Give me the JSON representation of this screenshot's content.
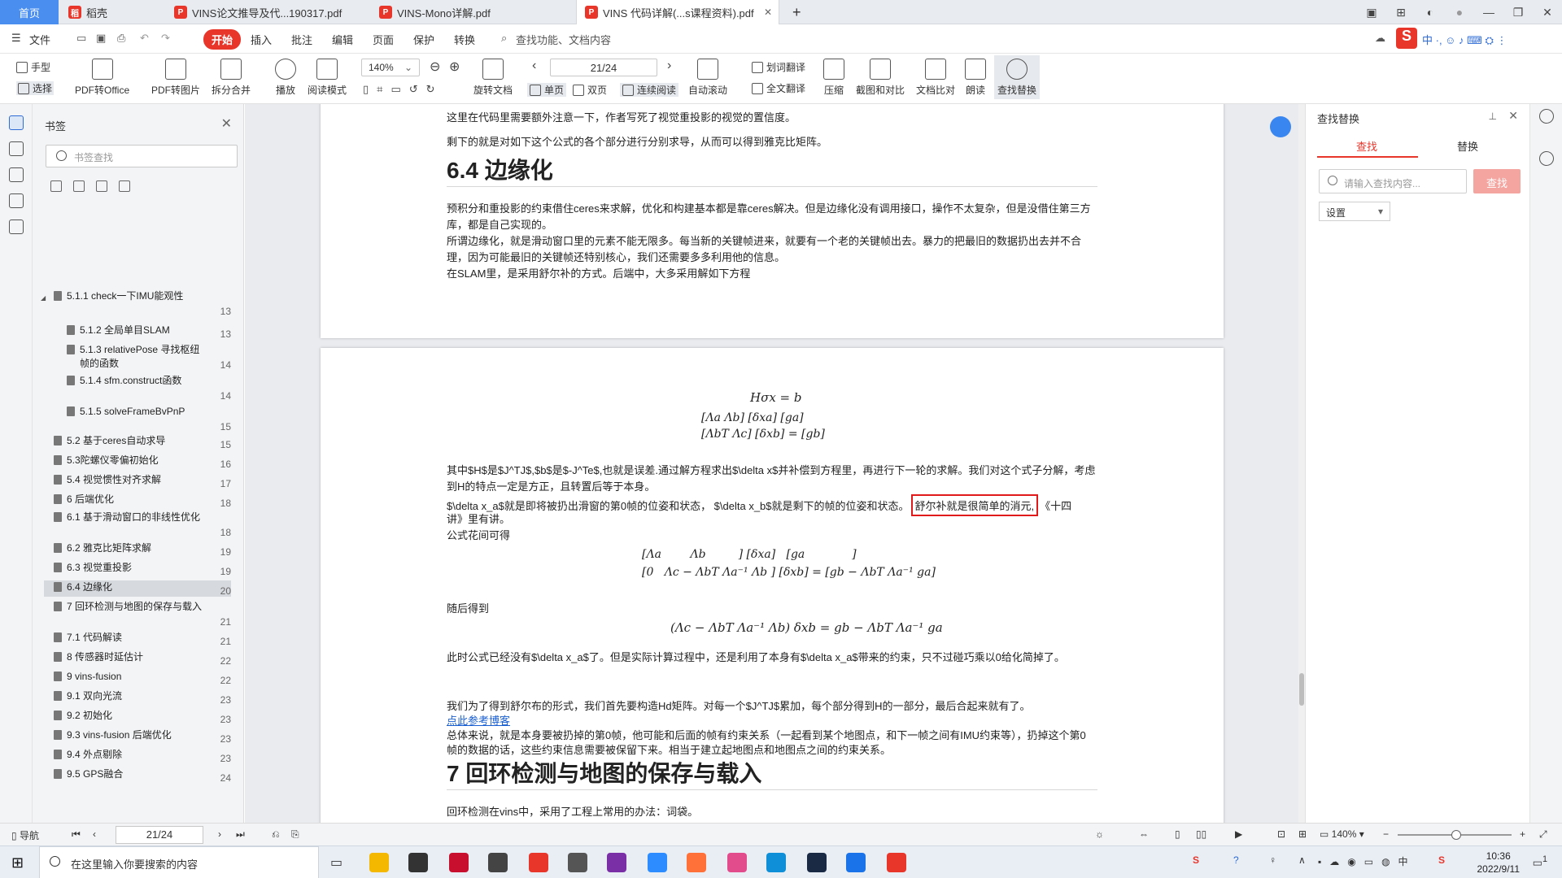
{
  "tabs": [
    {
      "label": "首页"
    },
    {
      "label": "稻壳"
    },
    {
      "label": "VINS论文推导及代...190317.pdf"
    },
    {
      "label": "VINS-Mono详解.pdf"
    },
    {
      "label": "VINS 代码详解(...s课程资料).pdf"
    }
  ],
  "tab_close": "✕",
  "new_tab": "+",
  "window_buttons": [
    "—",
    "❐",
    "✕"
  ],
  "menu": {
    "file": "文件",
    "items": [
      "开始",
      "插入",
      "批注",
      "编辑",
      "页面",
      "保护",
      "转换"
    ],
    "search": "查找功能、文档内容"
  },
  "toolbar": {
    "hand": "手型",
    "select": "选择",
    "pdf_office": "PDF转Office",
    "pdf_image": "PDF转图片",
    "split_merge": "拆分合并",
    "play": "播放",
    "read_mode": "阅读模式",
    "zoom": "140%",
    "rotate": "旋转文档",
    "page": "21/24",
    "single": "单页",
    "double": "双页",
    "continuous": "连续阅读",
    "auto_scroll": "自动滚动",
    "translate_word": "划词翻译",
    "translate_all": "全文翻译",
    "compress": "压缩",
    "screenshot": "截图和对比",
    "compare": "文档比对",
    "read_aloud": "朗读",
    "find_replace": "查找替换"
  },
  "sidebar": {
    "title": "书签",
    "search_placeholder": "书签查找",
    "items": [
      {
        "label": "5.1.1 check一下IMU能观性",
        "page": "13",
        "indent": 0,
        "expanded": true
      },
      {
        "label": "5.1.2 全局单目SLAM",
        "page": "13",
        "indent": 1
      },
      {
        "label": "5.1.3 relativePose 寻找枢纽帧的函数",
        "page": "14",
        "indent": 1
      },
      {
        "label": "5.1.4 sfm.construct函数",
        "page": "14",
        "indent": 1
      },
      {
        "label": "5.1.5 solveFrameBvPnP",
        "page": "15",
        "indent": 1
      },
      {
        "label": "5.2 基于ceres自动求导",
        "page": "15",
        "indent": 0
      },
      {
        "label": "5.3陀螺仪零偏初始化",
        "page": "16",
        "indent": 0
      },
      {
        "label": "5.4 视觉惯性对齐求解",
        "page": "17",
        "indent": 0
      },
      {
        "label": "6 后端优化",
        "page": "18",
        "indent": 0
      },
      {
        "label": "6.1 基于滑动窗口的非线性优化",
        "page": "18",
        "indent": 0
      },
      {
        "label": "6.2 雅克比矩阵求解",
        "page": "19",
        "indent": 0
      },
      {
        "label": "6.3 视觉重投影",
        "page": "19",
        "indent": 0
      },
      {
        "label": "6.4 边缘化",
        "page": "20",
        "indent": 0,
        "selected": true
      },
      {
        "label": "7 回环检测与地图的保存与载入",
        "page": "21",
        "indent": 0
      },
      {
        "label": "7.1 代码解读",
        "page": "21",
        "indent": 0
      },
      {
        "label": "8 传感器时延估计",
        "page": "22",
        "indent": 0
      },
      {
        "label": "9 vins-fusion",
        "page": "22",
        "indent": 0
      },
      {
        "label": "9.1 双向光流",
        "page": "23",
        "indent": 0
      },
      {
        "label": "9.2 初始化",
        "page": "23",
        "indent": 0
      },
      {
        "label": "9.3 vins-fusion 后端优化",
        "page": "23",
        "indent": 0
      },
      {
        "label": "9.4 外点剔除",
        "page": "23",
        "indent": 0
      },
      {
        "label": "9.5 GPS融合",
        "page": "24",
        "indent": 0
      }
    ]
  },
  "doc": {
    "p1": [
      "这里在代码里需要额外注意一下，作者写死了视觉重投影的视觉的置信度。",
      "剩下的就是对如下这个公式的各个部分进行分别求导，从而可以得到雅克比矩阵。"
    ],
    "h64": "6.4 边缘化",
    "p2": [
      "预积分和重投影的约束借住ceres来求解，优化和构建基本都是靠ceres解决。但是边缘化没有调用接口，操作不太复杂，但是没借住第三方",
      "库，都是自己实现的。",
      "所谓边缘化，就是滑动窗口里的元素不能无限多。每当新的关键帧进来，就要有一个老的关键帧出去。暴力的把最旧的数据扔出去并不合",
      "理，因为可能最旧的关键帧还特别核心，我们还需要多多利用他的信息。",
      "在SLAM里，是采用舒尔补的方式。后端中，大多采用解如下方程"
    ],
    "eq1": "Hσx = b",
    "eq2a": "[Λa   Λb] [δxa]   [ga]",
    "eq2b": "[ΛbT  Λc] [δxb] = [gb]",
    "p3": [
      "其中$H$是$J^TJ$,$b$是$-J^Te$,也就是误差.通过解方程求出$\\delta x$并补偿到方程里，再进行下一轮的求解。我们对这个式子分解，考虑",
      "到H的特点一定是方正，且转置后等于本身。"
    ],
    "p3_line3a": "$\\delta x_a$就是即将被扔出滑窗的第0帧的位姿和状态，  $\\delta x_b$就是剩下的帧的位姿和状态。",
    "p3_highlight": "舒尔补就是很简单的消元,",
    "p3_line3c": "《十四",
    "p3_line4": "讲》里有讲。",
    "p3_line5": "公式花间可得",
    "eq3a": "[Λa        Λb         ] [δxa]   [ga             ]",
    "eq3b": "[0   Λc − ΛbT Λa⁻¹ Λb ] [δxb] = [gb − ΛbT Λa⁻¹ ga]",
    "p4": "随后得到",
    "eq4": "(Λc − ΛbT Λa⁻¹ Λb) δxb = gb − ΛbT Λa⁻¹ ga",
    "p5": "此时公式已经没有$\\delta x_a$了。但是实际计算过程中，还是利用了本身有$\\delta x_a$带来的约束，只不过碰巧乘以0给化简掉了。",
    "p6": "我们为了得到舒尔布的形式，我们首先要构造Hd矩阵。对每一个$J^TJ$累加，每个部分得到H的一部分，最后合起来就有了。",
    "link": "点此参考博客",
    "p7": [
      "总体来说，就是本身要被扔掉的第0帧，他可能和后面的帧有约束关系（一起看到某个地图点，和下一帧之间有IMU约束等），扔掉这个第0",
      "帧的数据的话，这些约束信息需要被保留下来。相当于建立起地图点和地图点之间的约束关系。"
    ],
    "h7": "7 回环检测与地图的保存与载入",
    "p8": "回环检测在vins中，采用了工程上常用的办法：词袋。"
  },
  "right_panel": {
    "title": "查找替换",
    "tab_find": "查找",
    "tab_replace": "替换",
    "input_placeholder": "请输入查找内容...",
    "find_button": "查找",
    "settings": "设置"
  },
  "status": {
    "nav": "导航",
    "page": "21/24",
    "zoom": "140%"
  },
  "taskbar": {
    "search_placeholder": "在这里输入你要搜索的内容",
    "time": "10:36",
    "date": "2022/9/11",
    "notify_count": "1"
  },
  "colors": {
    "accent_red": "#e8362b",
    "home_tab": "#4a8ff0",
    "highlight_box": "#e01a1a",
    "link_blue": "#1a5fd1"
  }
}
